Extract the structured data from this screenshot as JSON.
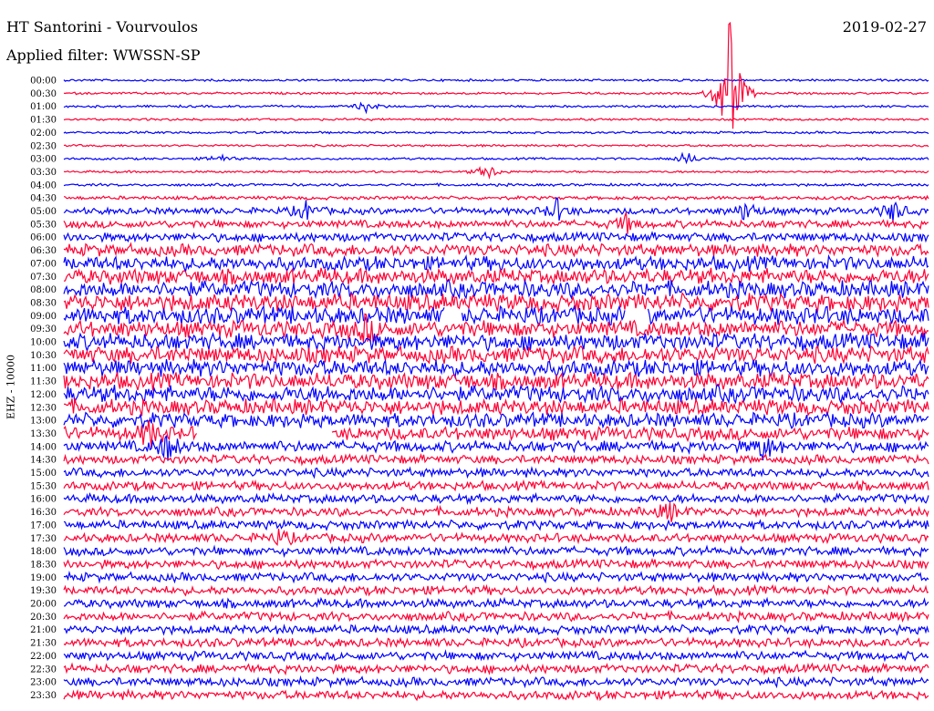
{
  "header": {
    "station": "HT Santorini - Vourvoulos",
    "date": "2019-02-27",
    "filter": "Applied filter: WWSSN-SP"
  },
  "chart_data": {
    "type": "line",
    "title": "HT Santorini - Vourvoulos",
    "ylabel": "EHZ - 10000",
    "row_labels": [
      "00:00",
      "00:30",
      "01:00",
      "01:30",
      "02:00",
      "02:30",
      "03:00",
      "03:30",
      "04:00",
      "04:30",
      "05:00",
      "05:30",
      "06:00",
      "06:30",
      "07:00",
      "07:30",
      "08:00",
      "08:30",
      "09:00",
      "09:30",
      "10:00",
      "10:30",
      "11:00",
      "11:30",
      "12:00",
      "12:30",
      "13:00",
      "13:30",
      "14:00",
      "14:30",
      "15:00",
      "15:30",
      "16:00",
      "16:30",
      "17:00",
      "17:30",
      "18:00",
      "18:30",
      "19:00",
      "19:30",
      "20:00",
      "20:30",
      "21:00",
      "21:30",
      "22:00",
      "22:30",
      "23:00",
      "23:30"
    ],
    "colors": [
      "#0000ff",
      "#ff0033"
    ],
    "noise_level": [
      1,
      1,
      1,
      1,
      1,
      1,
      1,
      1,
      1.2,
      1.6,
      3,
      3.5,
      4,
      5.5,
      6.5,
      7,
      7.5,
      8,
      8,
      7.5,
      7.5,
      7.5,
      7.5,
      7.5,
      7.5,
      7,
      6.5,
      6,
      5,
      4,
      4,
      4,
      4,
      4,
      4,
      4,
      4,
      4,
      4,
      4,
      4,
      4,
      4,
      4,
      4,
      4,
      4,
      4
    ],
    "events": [
      {
        "row": 1,
        "x": 0.77,
        "amp": 90
      },
      {
        "row": 2,
        "x": 0.35,
        "amp": 6
      },
      {
        "row": 6,
        "x": 0.18,
        "amp": 5
      },
      {
        "row": 6,
        "x": 0.72,
        "amp": 8
      },
      {
        "row": 7,
        "x": 0.49,
        "amp": 9
      },
      {
        "row": 10,
        "x": 0.28,
        "amp": 10
      },
      {
        "row": 10,
        "x": 0.57,
        "amp": 12
      },
      {
        "row": 10,
        "x": 0.79,
        "amp": 12
      },
      {
        "row": 10,
        "x": 0.96,
        "amp": 12
      },
      {
        "row": 11,
        "x": 0.65,
        "amp": 10
      },
      {
        "row": 19,
        "x": 0.35,
        "amp": 14
      },
      {
        "row": 27,
        "x": 0.1,
        "amp": 14
      },
      {
        "row": 28,
        "x": 0.12,
        "amp": 14
      },
      {
        "row": 28,
        "x": 0.81,
        "amp": 14
      },
      {
        "row": 33,
        "x": 0.7,
        "amp": 10
      },
      {
        "row": 35,
        "x": 0.25,
        "amp": 8
      }
    ],
    "gaps": [
      {
        "row": 18,
        "from": 0.44,
        "to": 0.46
      },
      {
        "row": 18,
        "from": 0.65,
        "to": 0.675
      },
      {
        "row": 27,
        "from": 0.155,
        "to": 0.31
      }
    ]
  }
}
